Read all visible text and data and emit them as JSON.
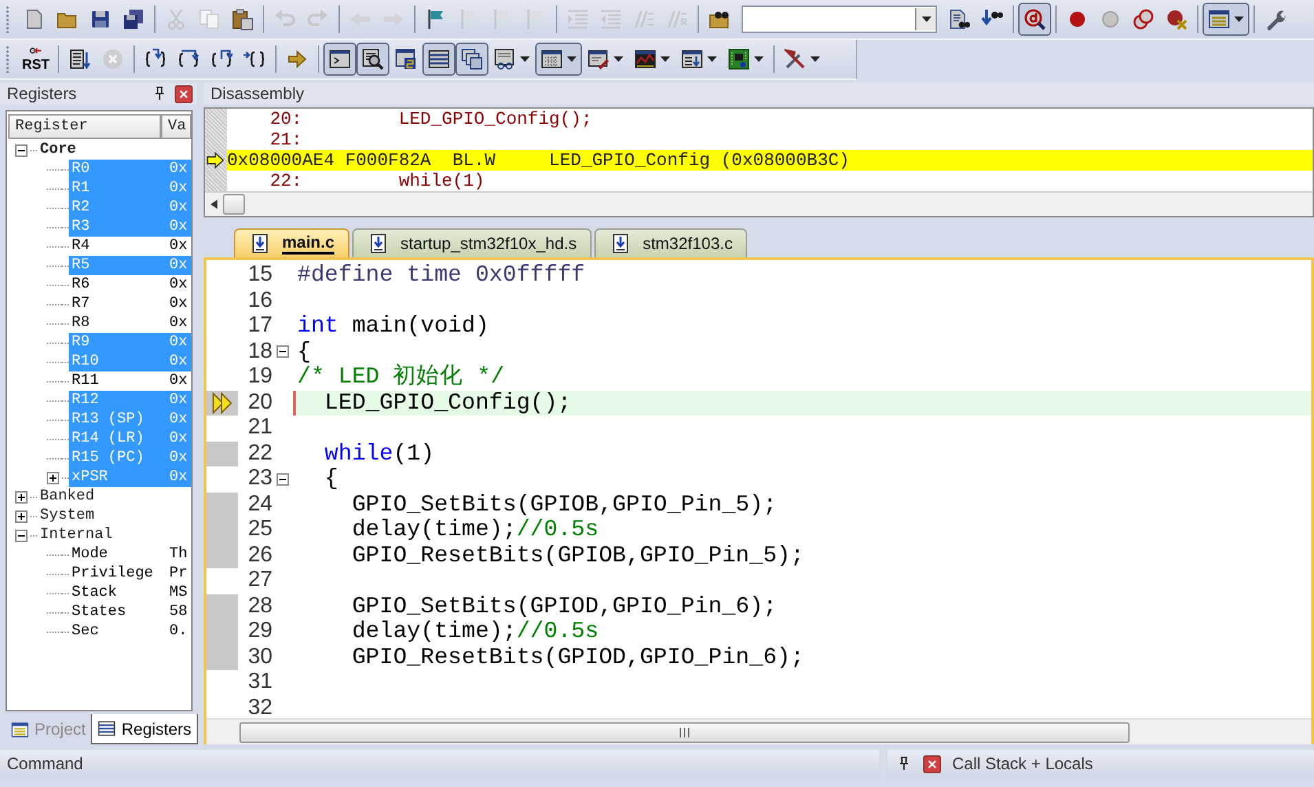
{
  "toolbars": [
    {
      "items": [
        {
          "kind": "button",
          "disabled": false,
          "pressed": false,
          "menu": false
        },
        {
          "kind": "button",
          "disabled": false,
          "pressed": false,
          "menu": false
        },
        {
          "kind": "button",
          "disabled": false,
          "pressed": false,
          "menu": false
        },
        {
          "kind": "button",
          "disabled": false,
          "pressed": false,
          "menu": false
        },
        {
          "kind": "separator"
        },
        {
          "kind": "button",
          "disabled": true,
          "pressed": false,
          "menu": false
        },
        {
          "kind": "button",
          "disabled": true,
          "pressed": false,
          "menu": false
        },
        {
          "kind": "button",
          "disabled": false,
          "pressed": false,
          "menu": false
        },
        {
          "kind": "separator"
        },
        {
          "kind": "button",
          "disabled": true,
          "pressed": false,
          "menu": false
        },
        {
          "kind": "button",
          "disabled": true,
          "pressed": false,
          "menu": false
        },
        {
          "kind": "separator"
        },
        {
          "kind": "button",
          "disabled": true,
          "pressed": false,
          "menu": false
        },
        {
          "kind": "button",
          "disabled": true,
          "pressed": false,
          "menu": false
        },
        {
          "kind": "separator"
        },
        {
          "kind": "button",
          "disabled": false,
          "pressed": false,
          "menu": false
        },
        {
          "kind": "button",
          "disabled": true,
          "pressed": false,
          "menu": false
        },
        {
          "kind": "button",
          "disabled": true,
          "pressed": false,
          "menu": false
        },
        {
          "kind": "button",
          "disabled": true,
          "pressed": false,
          "menu": false
        },
        {
          "kind": "separator"
        },
        {
          "kind": "button",
          "disabled": true,
          "pressed": false,
          "menu": false
        },
        {
          "kind": "button",
          "disabled": true,
          "pressed": false,
          "menu": false
        },
        {
          "kind": "button",
          "disabled": true,
          "pressed": false,
          "menu": false
        },
        {
          "kind": "button",
          "disabled": true,
          "pressed": false,
          "menu": false
        },
        {
          "kind": "separator"
        },
        {
          "kind": "button",
          "disabled": false,
          "pressed": false,
          "menu": false
        },
        {
          "kind": "combo"
        },
        {
          "kind": "button",
          "disabled": false,
          "pressed": false,
          "menu": false
        },
        {
          "kind": "button",
          "disabled": false,
          "pressed": false,
          "menu": false
        },
        {
          "kind": "separator"
        },
        {
          "kind": "button",
          "disabled": false,
          "pressed": true,
          "menu": false
        },
        {
          "kind": "separator"
        },
        {
          "kind": "button",
          "disabled": false,
          "pressed": false,
          "menu": false
        },
        {
          "kind": "button",
          "disabled": false,
          "pressed": false,
          "menu": false
        },
        {
          "kind": "button",
          "disabled": false,
          "pressed": false,
          "menu": false
        },
        {
          "kind": "button",
          "disabled": false,
          "pressed": false,
          "menu": false
        },
        {
          "kind": "separator"
        },
        {
          "kind": "button",
          "disabled": false,
          "pressed": true,
          "menu": true
        },
        {
          "kind": "separator"
        },
        {
          "kind": "button",
          "disabled": false,
          "pressed": false,
          "menu": false
        }
      ]
    },
    {
      "items": [
        {
          "kind": "button",
          "label": "RST",
          "disabled": false,
          "pressed": false,
          "menu": false
        },
        {
          "kind": "separator"
        },
        {
          "kind": "button",
          "disabled": false,
          "pressed": false,
          "menu": false
        },
        {
          "kind": "button",
          "disabled": true,
          "pressed": false,
          "menu": false
        },
        {
          "kind": "separator"
        },
        {
          "kind": "button",
          "disabled": false,
          "pressed": false,
          "menu": false
        },
        {
          "kind": "button",
          "disabled": false,
          "pressed": false,
          "menu": false
        },
        {
          "kind": "button",
          "disabled": false,
          "pressed": false,
          "menu": false
        },
        {
          "kind": "button",
          "disabled": false,
          "pressed": false,
          "menu": false
        },
        {
          "kind": "separator"
        },
        {
          "kind": "button",
          "disabled": false,
          "pressed": false,
          "menu": false
        },
        {
          "kind": "separator"
        },
        {
          "kind": "button",
          "disabled": false,
          "pressed": true,
          "menu": false
        },
        {
          "kind": "button",
          "disabled": false,
          "pressed": true,
          "menu": false
        },
        {
          "kind": "button",
          "disabled": false,
          "pressed": false,
          "menu": false
        },
        {
          "kind": "button",
          "disabled": false,
          "pressed": true,
          "menu": false
        },
        {
          "kind": "button",
          "disabled": false,
          "pressed": true,
          "menu": false
        },
        {
          "kind": "button",
          "disabled": false,
          "pressed": false,
          "menu": true
        },
        {
          "kind": "button",
          "disabled": false,
          "pressed": true,
          "menu": true
        },
        {
          "kind": "button",
          "disabled": false,
          "pressed": false,
          "menu": true
        },
        {
          "kind": "button",
          "disabled": false,
          "pressed": false,
          "menu": true
        },
        {
          "kind": "button",
          "disabled": false,
          "pressed": false,
          "menu": true
        },
        {
          "kind": "button",
          "disabled": false,
          "pressed": false,
          "menu": true
        },
        {
          "kind": "separator"
        },
        {
          "kind": "button",
          "disabled": false,
          "pressed": false,
          "menu": true
        }
      ]
    }
  ],
  "registers_panel": {
    "title": "Registers",
    "columns": [
      "Register",
      "Va"
    ],
    "items": [
      {
        "name": "Core",
        "expanded": true,
        "children": [
          {
            "name": "R0",
            "value": "0x",
            "selected": true
          },
          {
            "name": "R1",
            "value": "0x",
            "selected": true
          },
          {
            "name": "R2",
            "value": "0x",
            "selected": true
          },
          {
            "name": "R3",
            "value": "0x",
            "selected": true
          },
          {
            "name": "R4",
            "value": "0x",
            "selected": false
          },
          {
            "name": "R5",
            "value": "0x",
            "selected": true
          },
          {
            "name": "R6",
            "value": "0x",
            "selected": false
          },
          {
            "name": "R7",
            "value": "0x",
            "selected": false
          },
          {
            "name": "R8",
            "value": "0x",
            "selected": false
          },
          {
            "name": "R9",
            "value": "0x",
            "selected": true
          },
          {
            "name": "R10",
            "value": "0x",
            "selected": true
          },
          {
            "name": "R11",
            "value": "0x",
            "selected": false
          },
          {
            "name": "R12",
            "value": "0x",
            "selected": true
          },
          {
            "name": "R13 (SP)",
            "value": "0x",
            "selected": true
          },
          {
            "name": "R14 (LR)",
            "value": "0x",
            "selected": true
          },
          {
            "name": "R15 (PC)",
            "value": "0x",
            "selected": true
          },
          {
            "name": "xPSR",
            "value": "0x",
            "selected": true,
            "expanded": false
          }
        ]
      },
      {
        "name": "Banked",
        "expanded": false
      },
      {
        "name": "System",
        "expanded": false
      },
      {
        "name": "Internal",
        "expanded": true,
        "children": [
          {
            "name": "Mode",
            "value": "Th",
            "selected": false
          },
          {
            "name": "Privilege",
            "value": "Pr",
            "selected": false
          },
          {
            "name": "Stack",
            "value": "MS",
            "selected": false
          },
          {
            "name": "States",
            "value": "58",
            "selected": false
          },
          {
            "name": "Sec",
            "value": "0.",
            "selected": false
          }
        ]
      }
    ],
    "tabs": [
      {
        "label": "Project",
        "selected": false
      },
      {
        "label": "Registers",
        "selected": true
      }
    ]
  },
  "disassembly": {
    "title": "Disassembly",
    "lines": [
      {
        "text": "    20:         LED_GPIO_Config();",
        "current": false
      },
      {
        "text": "    21: ",
        "current": false
      },
      {
        "text": "0x08000AE4 F000F82A  BL.W     LED_GPIO_Config (0x08000B3C)",
        "current": true
      },
      {
        "text": "    22:         while(1)",
        "current": false
      }
    ]
  },
  "editor": {
    "tabs": [
      {
        "label": "main.c",
        "selected": true
      },
      {
        "label": "startup_stm32f10x_hd.s",
        "selected": false
      },
      {
        "label": "stm32f103.c",
        "selected": false
      }
    ],
    "lines": [
      {
        "number": "15",
        "segments": [
          {
            "kind": "preprocessor",
            "text": "#define time 0x0fffff"
          }
        ],
        "executable": false,
        "current": false,
        "fold": false
      },
      {
        "number": "16",
        "executable": false,
        "current": false,
        "fold": false
      },
      {
        "number": "17",
        "segments": [
          {
            "kind": "keyword",
            "text": "int"
          },
          {
            "kind": "plain",
            "text": " main(void)"
          }
        ],
        "executable": false,
        "current": false,
        "fold": false
      },
      {
        "number": "18",
        "segments": [
          {
            "kind": "plain",
            "text": "{"
          }
        ],
        "executable": false,
        "current": false,
        "fold": true
      },
      {
        "number": "19",
        "segments": [
          {
            "kind": "comment",
            "text": "/* LED 初始化 */"
          }
        ],
        "executable": false,
        "current": false,
        "fold": false
      },
      {
        "number": "20",
        "segments": [
          {
            "kind": "plain",
            "text": "  LED_GPIO_Config();"
          }
        ],
        "executable": true,
        "current": true,
        "fold": false
      },
      {
        "number": "21",
        "executable": false,
        "current": false,
        "fold": false
      },
      {
        "number": "22",
        "segments": [
          {
            "kind": "keyword",
            "text": "  while"
          },
          {
            "kind": "plain",
            "text": "(1)"
          }
        ],
        "executable": true,
        "current": false,
        "fold": false
      },
      {
        "number": "23",
        "segments": [
          {
            "kind": "plain",
            "text": "  {"
          }
        ],
        "executable": false,
        "current": false,
        "fold": true
      },
      {
        "number": "24",
        "segments": [
          {
            "kind": "plain",
            "text": "    GPIO_SetBits(GPIOB,GPIO_Pin_5);"
          }
        ],
        "executable": true,
        "current": false,
        "fold": false
      },
      {
        "number": "25",
        "segments": [
          {
            "kind": "plain",
            "text": "    delay(time);"
          },
          {
            "kind": "comment",
            "text": "//0.5s"
          }
        ],
        "executable": true,
        "current": false,
        "fold": false
      },
      {
        "number": "26",
        "segments": [
          {
            "kind": "plain",
            "text": "    GPIO_ResetBits(GPIOB,GPIO_Pin_5);"
          }
        ],
        "executable": true,
        "current": false,
        "fold": false
      },
      {
        "number": "27",
        "executable": false,
        "current": false,
        "fold": false
      },
      {
        "number": "28",
        "segments": [
          {
            "kind": "plain",
            "text": "    GPIO_SetBits(GPIOD,GPIO_Pin_6);"
          }
        ],
        "executable": true,
        "current": false,
        "fold": false
      },
      {
        "number": "29",
        "segments": [
          {
            "kind": "plain",
            "text": "    delay(time);"
          },
          {
            "kind": "comment",
            "text": "//0.5s"
          }
        ],
        "executable": true,
        "current": false,
        "fold": false
      },
      {
        "number": "30",
        "segments": [
          {
            "kind": "plain",
            "text": "    GPIO_ResetBits(GPIOD,GPIO_Pin_6);"
          }
        ],
        "executable": true,
        "current": false,
        "fold": false
      },
      {
        "number": "31",
        "executable": false,
        "current": false,
        "fold": false
      },
      {
        "number": "32",
        "executable": false,
        "current": false,
        "fold": false
      }
    ]
  },
  "bottom": {
    "left_title": "Command",
    "right_title": "Call Stack + Locals"
  }
}
